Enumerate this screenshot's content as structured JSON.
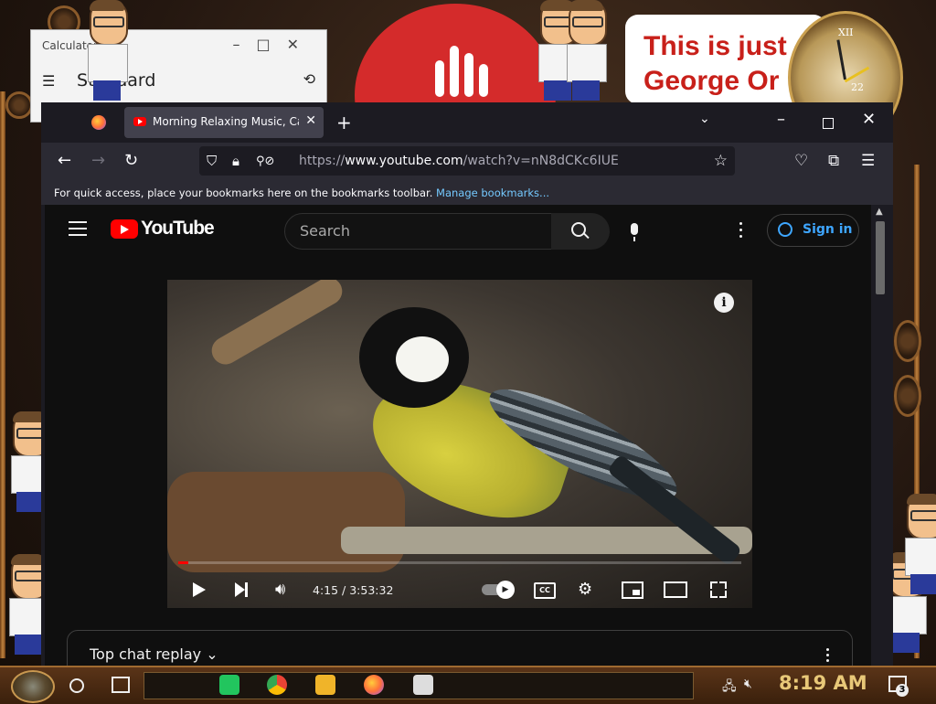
{
  "calculator": {
    "title": "Calculator",
    "mode": "Standard"
  },
  "background_sign": {
    "line1": "This is just",
    "line2": "George Or"
  },
  "clock_face": {
    "numeral_top": "XII",
    "date_window": "22"
  },
  "browser": {
    "tab_title": "Morning Relaxing Music, Calm",
    "url_prefix": "https://",
    "url_host": "www.youtube.com",
    "url_path": "/watch?v=nN8dCKc6IUE",
    "bookmarks_text": "For quick access, place your bookmarks here on the bookmarks toolbar.",
    "bookmarks_link": "Manage bookmarks..."
  },
  "youtube": {
    "logo_text": "YouTube",
    "search_placeholder": "Search",
    "sign_in": "Sign in",
    "info": "i",
    "video_time": "4:15 / 3:53:32",
    "video_progress": 0.018,
    "cc": "CC",
    "chat_label": "Top chat replay"
  },
  "taskbar": {
    "time": "8:19 AM",
    "notification_count": "3"
  },
  "colors": {
    "youtube_red": "#ff0000",
    "link_blue": "#3ea6ff",
    "browser_dark": "#1c1b22",
    "clock_gold": "#e8c878"
  }
}
